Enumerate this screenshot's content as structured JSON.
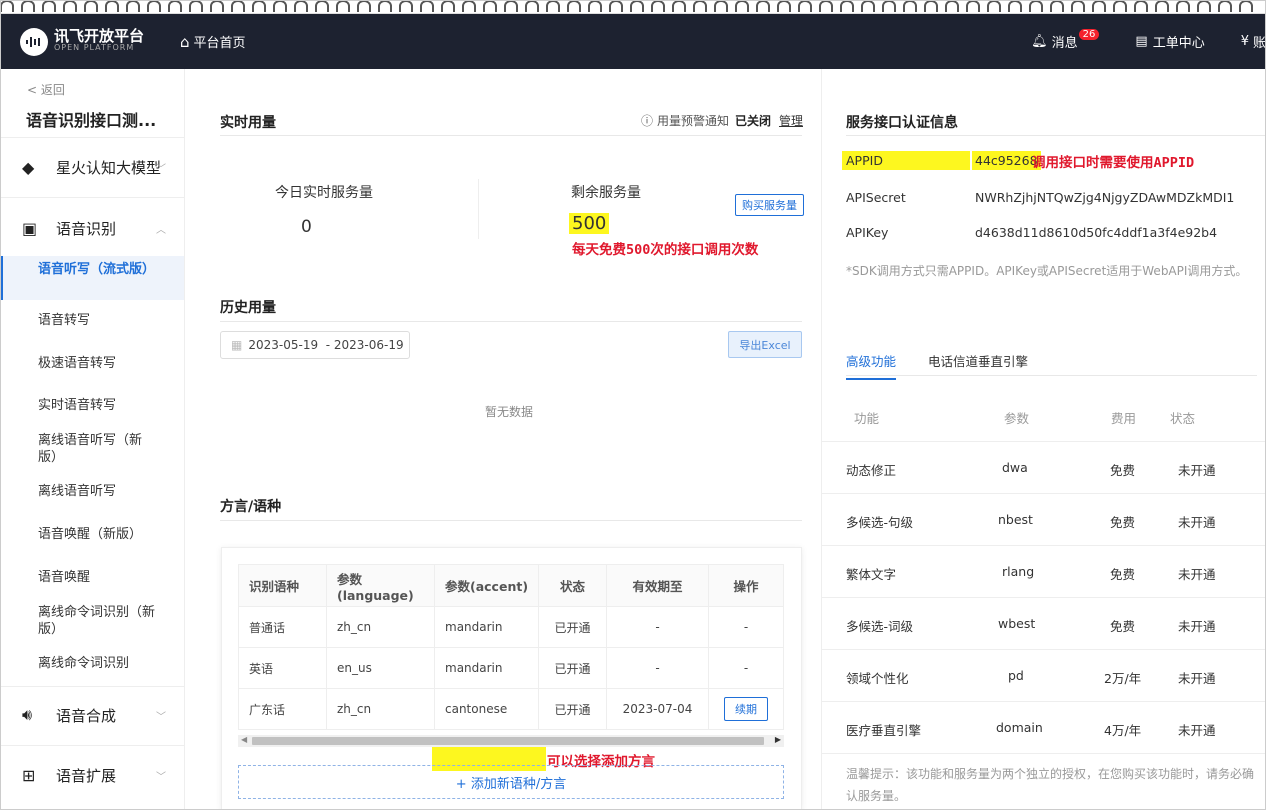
{
  "header": {
    "logo_title": "讯飞开放平台",
    "logo_sub": "OPEN PLATFORM",
    "logo_mark": "iflytek",
    "home_label": "平台首页",
    "messages_label": "消息",
    "messages_count": "26",
    "tickets_label": "工单中心",
    "cut_label": "账"
  },
  "sidebar": {
    "back": "< 返回",
    "title": "语音识别接口测...",
    "groups": {
      "spark": "星火认知大模型",
      "asr": "语音识别",
      "tts": "语音合成",
      "ext": "语音扩展"
    },
    "items": [
      "语音听写（流式版）",
      "语音转写",
      "极速语音转写",
      "实时语音转写",
      "离线语音听写（新版）",
      "离线语音听写",
      "语音唤醒（新版）",
      "语音唤醒",
      "离线命令词识别（新版）",
      "离线命令词识别"
    ]
  },
  "main": {
    "realtime_title": "实时用量",
    "warn_label": "用量预警通知",
    "warn_state": "已关闭",
    "warn_manage": "管理",
    "today_label": "今日实时服务量",
    "today_value": "0",
    "remain_label": "剩余服务量",
    "remain_value": "500",
    "buy_label": "购买服务量",
    "remain_annotation": "每天免费500次的接口调用次数",
    "history_title": "历史用量",
    "date_range": "2023-05-19  - 2023-06-19",
    "export_label": "导出Excel",
    "no_data": "暂无数据",
    "dialect_title": "方言/语种",
    "table": {
      "headers": [
        "识别语种",
        "参数(language)",
        "参数(accent)",
        "状态",
        "有效期至",
        "操作"
      ],
      "rows": [
        [
          "普通话",
          "zh_cn",
          "mandarin",
          "已开通",
          "-",
          "-"
        ],
        [
          "英语",
          "en_us",
          "mandarin",
          "已开通",
          "-",
          "-"
        ],
        [
          "广东话",
          "zh_cn",
          "cantonese",
          "已开通",
          "2023-07-04",
          "续期"
        ]
      ]
    },
    "add_annotation": "可以选择添加方言",
    "add_label": "+ 添加新语种/方言"
  },
  "right": {
    "title": "服务接口认证信息",
    "appid_key": "APPID",
    "appid_value": "44c95268",
    "appid_annotation": "调用接口时需要使用APPID",
    "secret_key": "APISecret",
    "secret_value": "NWRhZjhjNTQwZjg4NjgyZDAwMDZkMDI1",
    "apikey_key": "APIKey",
    "apikey_value": "d4638d11d8610d50fc4ddf1a3f4e92b4",
    "note": "*SDK调用方式只需APPID。APIKey或APISecret适用于WebAPI调用方式。",
    "tabs": [
      "高级功能",
      "电话信道垂直引擎"
    ],
    "feature_headers": [
      "功能",
      "参数",
      "费用",
      "状态"
    ],
    "features": [
      [
        "动态修正",
        "dwa",
        "免费",
        "未开通"
      ],
      [
        "多候选-句级",
        "nbest",
        "免费",
        "未开通"
      ],
      [
        "繁体文字",
        "rlang",
        "免费",
        "未开通"
      ],
      [
        "多候选-词级",
        "wbest",
        "免费",
        "未开通"
      ],
      [
        "领域个性化",
        "pd",
        "2万/年",
        "未开通"
      ],
      [
        "医疗垂直引擎",
        "domain",
        "4万/年",
        "未开通"
      ]
    ],
    "tip": "温馨提示：该功能和服务量为两个独立的授权，在您购买该功能时，请务必确认服务量。"
  },
  "colors": {
    "accent": "#1f6fd8",
    "topbar": "#1d2230",
    "highlight": "#fdf71f",
    "annotation": "#e0182d"
  }
}
